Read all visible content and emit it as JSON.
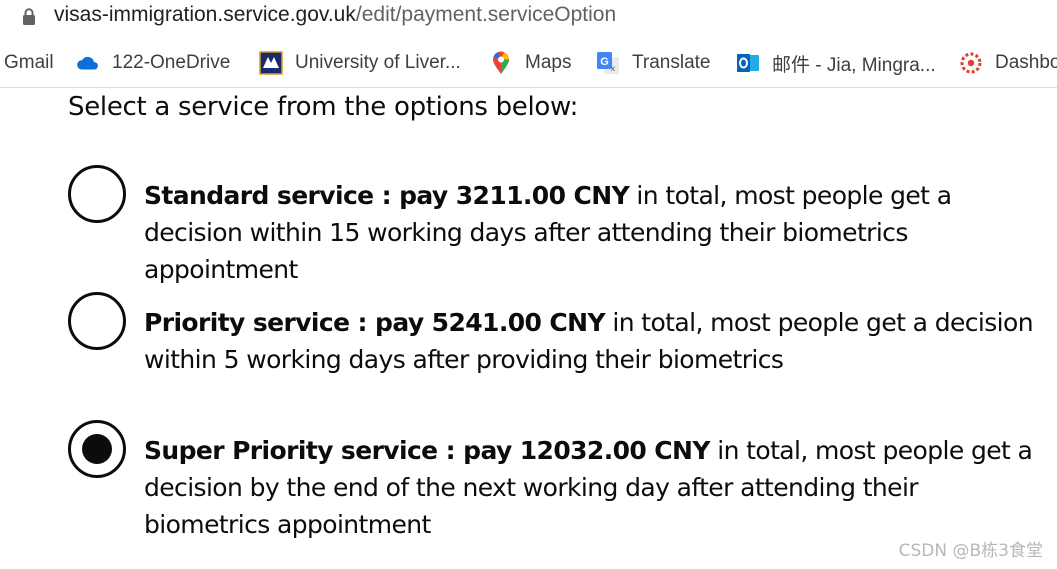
{
  "browser": {
    "url_host": "visas-immigration.service.gov.uk",
    "url_path": "/edit/payment.serviceOption"
  },
  "bookmarks": [
    {
      "label": "Gmail",
      "icon": "gmail-icon"
    },
    {
      "label": "122-OneDrive",
      "icon": "onedrive-icon"
    },
    {
      "label": "University of Liver...",
      "icon": "university-crest-icon"
    },
    {
      "label": "Maps",
      "icon": "maps-pin-icon"
    },
    {
      "label": "Translate",
      "icon": "translate-icon"
    },
    {
      "label": "邮件 - Jia, Mingra...",
      "icon": "outlook-icon"
    },
    {
      "label": "Dashbo",
      "icon": "canvas-icon"
    }
  ],
  "page": {
    "heading": "Select a service from the options below:",
    "options": [
      {
        "bold": "Standard service : pay 3211.00 CNY",
        "text": " in total, most people get a decision within 15 working days after attending their biometrics appointment",
        "selected": false
      },
      {
        "bold": "Priority service : pay 5241.00 CNY",
        "text": " in total, most people get a decision within 5 working days after providing their biometrics",
        "selected": false
      },
      {
        "bold": "Super Priority service : pay 12032.00 CNY",
        "text": " in total, most people get a decision by the end of the next working day after attending their biometrics appointment",
        "selected": true
      }
    ]
  },
  "watermark": "CSDN @B栋3食堂",
  "colors": {
    "text": "#0b0c0c",
    "url_path": "#5f6368",
    "bookmark_text": "#3c4043",
    "watermark": "#b8b8b8"
  }
}
